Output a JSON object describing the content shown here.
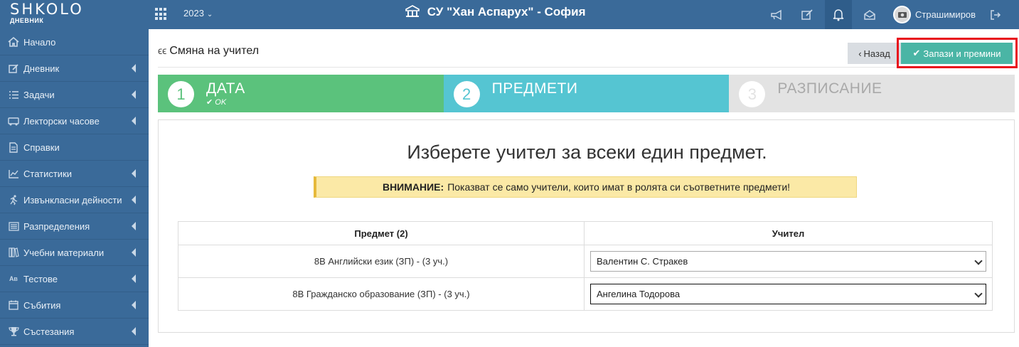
{
  "topbar": {
    "logo_main": "SHKOLO",
    "logo_sub": "ДНЕВНИК",
    "year": "2023",
    "school": "СУ \"Хан Аспарух\" - София",
    "username": "Страшимиров",
    "icons": [
      "apps-icon",
      "chevron-down-icon",
      "school-building-icon",
      "megaphone-icon",
      "edit-icon",
      "bell-icon",
      "envelope-open-icon",
      "avatar",
      "logout-icon"
    ]
  },
  "sidebar": {
    "items": [
      {
        "label": "Начало",
        "icon": "home-icon",
        "has_children": false
      },
      {
        "label": "Дневник",
        "icon": "edit-icon",
        "has_children": true
      },
      {
        "label": "Задачи",
        "icon": "list-icon",
        "has_children": true
      },
      {
        "label": "Лекторски часове",
        "icon": "bus-icon",
        "has_children": true
      },
      {
        "label": "Справки",
        "icon": "document-icon",
        "has_children": false
      },
      {
        "label": "Статистики",
        "icon": "chart-icon",
        "has_children": true
      },
      {
        "label": "Извънкласни дейности",
        "icon": "running-icon",
        "has_children": true
      },
      {
        "label": "Разпределения",
        "icon": "list-alt-icon",
        "has_children": true
      },
      {
        "label": "Учебни материали",
        "icon": "books-icon",
        "has_children": true
      },
      {
        "label": "Тестове",
        "icon": "ab-icon",
        "has_children": true
      },
      {
        "label": "Събития",
        "icon": "calendar-icon",
        "has_children": true
      },
      {
        "label": "Състезания",
        "icon": "trophy-icon",
        "has_children": true
      }
    ]
  },
  "page": {
    "title": "Смяна на учител",
    "back_label": "Назад",
    "save_label": "Запази и премини"
  },
  "steps": [
    {
      "num": "1",
      "label": "ДАТА",
      "sub": "OK"
    },
    {
      "num": "2",
      "label": "ПРЕДМЕТИ",
      "sub": ""
    },
    {
      "num": "3",
      "label": "РАЗПИСАНИЕ",
      "sub": ""
    }
  ],
  "panel": {
    "heading": "Изберете учител за всеки един предмет.",
    "warning_bold": "ВНИМАНИЕ:",
    "warning_text": "Показват се само учители, които имат в ролята си съответните предмети!",
    "table": {
      "headers": [
        "Предмет (2)",
        "Учител"
      ],
      "rows": [
        {
          "subject": "8В Английски език (ЗП) - (3 уч.)",
          "teacher": "Валентин С. Стракев"
        },
        {
          "subject": "8В Гражданско образование (ЗП) - (3 уч.)",
          "teacher": "Ангелина Тодорова"
        }
      ]
    }
  },
  "colors": {
    "topbar": "#3a6a99",
    "step_done": "#5bc27c",
    "step_active": "#55c5d2",
    "step_todo": "#e3e3e3",
    "save_button": "#4ab5a5",
    "highlight": "#e8101c",
    "warning_bg": "#fbe9a6"
  }
}
